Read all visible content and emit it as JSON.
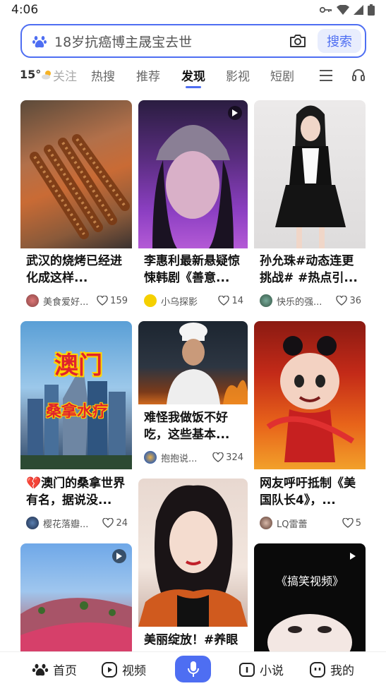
{
  "status_bar": {
    "time": "4:06"
  },
  "search": {
    "query": "18岁抗癌博主晟宝去世",
    "button_label": "搜索"
  },
  "weather": {
    "temperature": "15°"
  },
  "tabs": [
    {
      "label": "关注"
    },
    {
      "label": "热搜"
    },
    {
      "label": "推荐"
    },
    {
      "label": "发现",
      "active": true
    },
    {
      "label": "影视"
    },
    {
      "label": "短剧"
    }
  ],
  "feed": {
    "cards": [
      {
        "title_line1": "武汉的烧烤已经进",
        "title_line2": "化成这样...",
        "author": "美食爱好...",
        "likes": "159",
        "video": false
      },
      {
        "title_line1": "李惠利最新悬疑惊",
        "title_line2": "悚韩剧《善意...",
        "author": "小乌探影",
        "likes": "14",
        "video": true
      },
      {
        "title_line1": "孙允珠#动态连更",
        "title_line2": "挑战# #热点引...",
        "author": "快乐的强...",
        "likes": "36",
        "video": false
      },
      {
        "title_line1": "💔澳门的桑拿世界",
        "title_line2": "有名，据说没...",
        "author": "樱花落瓣...",
        "likes": "24",
        "video": false,
        "overlay_text_1": "澳门",
        "overlay_text_2": "桑拿水疗"
      },
      {
        "title_line1": "难怪我做饭不好",
        "title_line2": "吃，这些基本...",
        "author": "抱抱说...",
        "likes": "324",
        "video": false
      },
      {
        "title_line1": "网友呼吁抵制《美",
        "title_line2": "国队长4》，...",
        "author": "LQ雷蕾",
        "likes": "5",
        "video": false
      },
      {
        "title_line1": "美丽绽放！#养眼",
        "title_line2": "",
        "author": "",
        "likes": "",
        "video": false
      },
      {
        "title_line1": "",
        "title_line2": "",
        "author": "",
        "likes": "",
        "video": true
      },
      {
        "title_line1": "",
        "title_line2": "",
        "author": "",
        "likes": "",
        "video": true,
        "overlay_text_1": "《搞笑视频》"
      }
    ]
  },
  "bottom_nav": {
    "home": "首页",
    "video": "视频",
    "novel": "小说",
    "mine": "我的"
  },
  "colors": {
    "accent": "#4e6ef2"
  }
}
